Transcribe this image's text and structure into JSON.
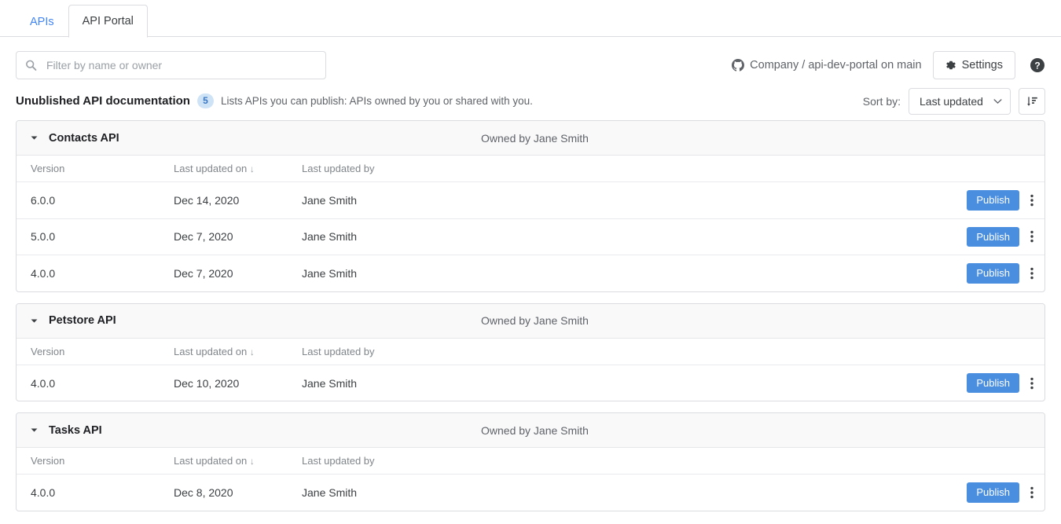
{
  "tabs": [
    {
      "label": "APIs",
      "active": false
    },
    {
      "label": "API Portal",
      "active": true
    }
  ],
  "toolbar": {
    "search_placeholder": "Filter by name or owner",
    "search_value": "",
    "repo_text": "Company / api-dev-portal on main",
    "settings_label": "Settings",
    "github_icon": "github-icon",
    "gear_icon": "gear-icon",
    "help_icon": "help-circle-icon"
  },
  "section": {
    "title": "Unublished API documentation",
    "count": "5",
    "description": "Lists APIs you can publish: APIs owned by you or shared with you.",
    "sort_label": "Sort by:",
    "sort_value": "Last updated",
    "sort_options": [
      "Last updated"
    ],
    "sort_direction_icon": "sort-descending-icon"
  },
  "table_headers": {
    "version": "Version",
    "updated_on": "Last updated on",
    "sort_indicator": "↓",
    "updated_by": "Last updated by"
  },
  "actions": {
    "publish_label": "Publish",
    "menu_icon": "kebab-menu-icon"
  },
  "colors": {
    "accent_blue": "#4285f4",
    "publish_blue": "#4a8ee0",
    "badge_bg": "#cfe3f7",
    "badge_text": "#3b78c3",
    "border": "#dadce0",
    "header_bg": "#f9f9fa",
    "muted_text": "#5f6368"
  },
  "groups": [
    {
      "name": "Contacts API",
      "owner": "Owned by Jane Smith",
      "expanded": true,
      "rows": [
        {
          "version": "6.0.0",
          "updated_on": "Dec 14, 2020",
          "updated_by": "Jane Smith"
        },
        {
          "version": "5.0.0",
          "updated_on": "Dec 7, 2020",
          "updated_by": "Jane Smith"
        },
        {
          "version": "4.0.0",
          "updated_on": "Dec 7, 2020",
          "updated_by": "Jane Smith"
        }
      ]
    },
    {
      "name": "Petstore API",
      "owner": "Owned by Jane Smith",
      "expanded": true,
      "rows": [
        {
          "version": "4.0.0",
          "updated_on": "Dec 10, 2020",
          "updated_by": "Jane Smith"
        }
      ]
    },
    {
      "name": "Tasks API",
      "owner": "Owned by Jane Smith",
      "expanded": true,
      "rows": [
        {
          "version": "4.0.0",
          "updated_on": "Dec 8, 2020",
          "updated_by": "Jane Smith"
        }
      ]
    }
  ]
}
